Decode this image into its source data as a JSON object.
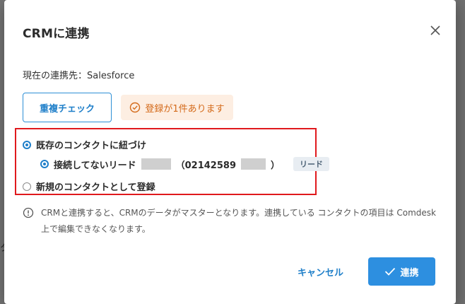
{
  "dialog": {
    "title": "CRMに連携",
    "current_target": "現在の連携先：Salesforce",
    "duplicate_check_label": "重複チェック",
    "duplicate_badge": "登録が1件あります",
    "options": {
      "existing_label": "既存のコンタクトに紐づけ",
      "sub_prefix": "接続してないリード",
      "sub_phone_open": "（02142589",
      "sub_phone_close": "）",
      "lead_badge": "リード",
      "new_label": "新規のコンタクトとして登録"
    },
    "note": "CRMと連携すると、CRMのデータがマスターとなります。連携している コンタクトの項目は Comdesk上で編集できなくなります。",
    "cancel_label": "キャンセル",
    "link_label": "連携"
  },
  "background": {
    "partial_char": "タ"
  },
  "colors": {
    "accent": "#2d8fe0",
    "warning_bg": "#fdeee2",
    "warning_text": "#d46a1a",
    "highlight": "#e0191d"
  }
}
